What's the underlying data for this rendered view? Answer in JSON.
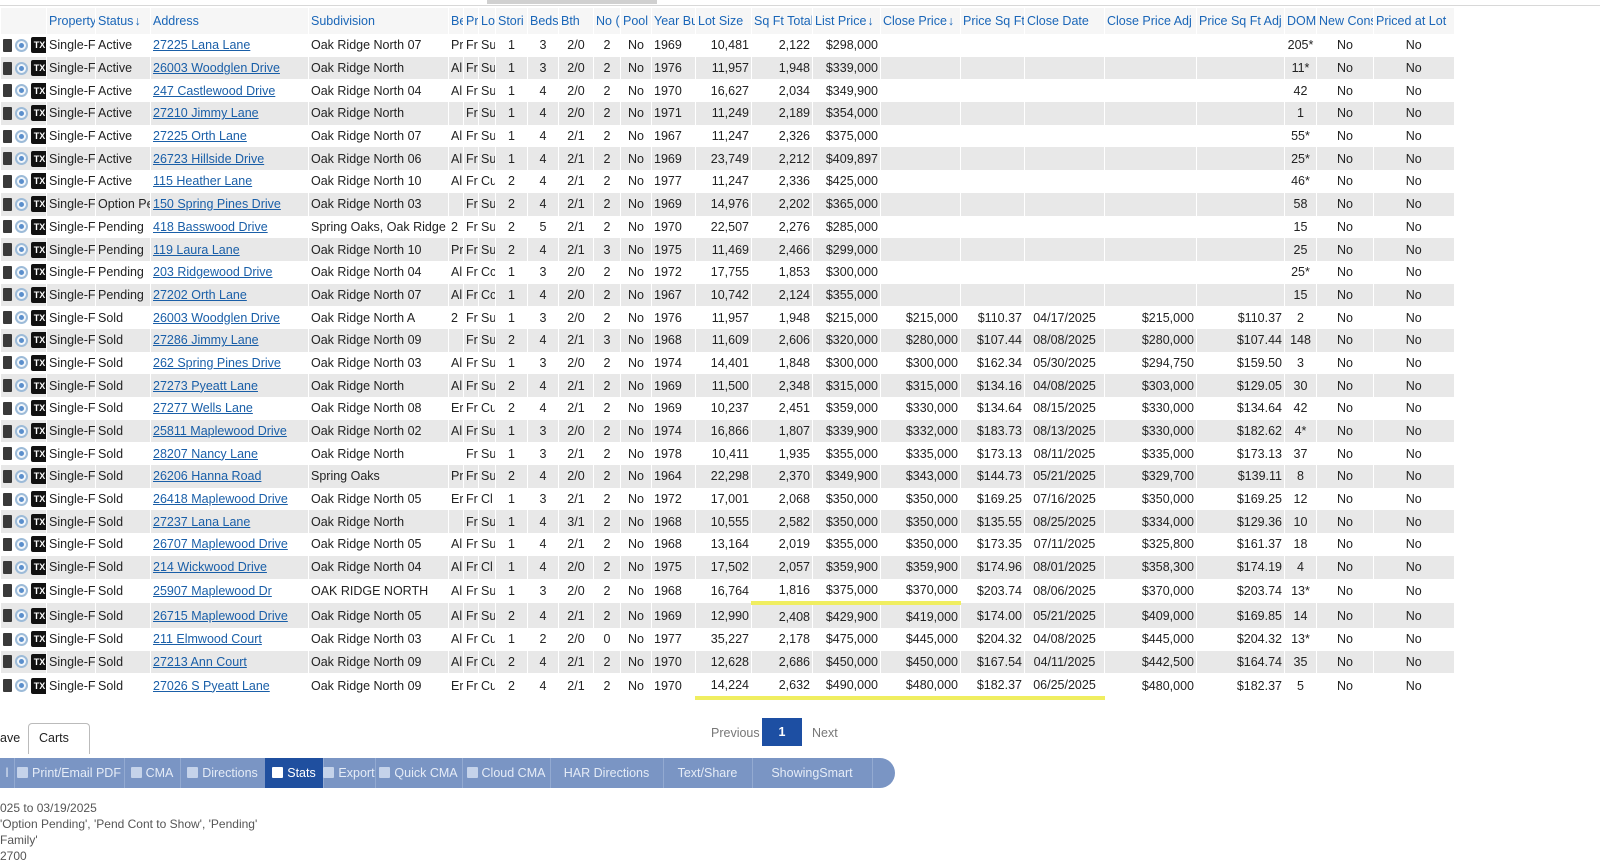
{
  "columns": [
    "",
    "Property",
    "Status",
    "Address",
    "Subdivision",
    "Be",
    "Pr",
    "Lo",
    "Stori",
    "Beds",
    "Bth",
    "No (",
    "Pool",
    "Year Bu",
    "Lot Size",
    "Sq Ft Total",
    "List Price",
    "Close Price",
    "Price Sq Ft",
    "Close Date",
    "Close Price Adj",
    "Price Sq Ft Adj",
    "DOM",
    "New Cons",
    "Priced at Lot"
  ],
  "sort_icons": {
    "status": "↓",
    "list_price": "↓",
    "close_price": "↓"
  },
  "row_icons": {
    "edit": "edit-icon",
    "globe": "globe-icon",
    "tx": "TX"
  },
  "rows": [
    {
      "prop": "Single-F",
      "status": "Active",
      "addr": "27225 Lana Lane",
      "sub": "Oak Ridge North 07",
      "be": "Pr",
      "pr": "Fr",
      "lo": "Su",
      "st": "1",
      "beds": "3",
      "bth": "2/0",
      "no": "2",
      "pool": "No",
      "yr": "1969",
      "lot": "10,481",
      "sqft": "2,122",
      "list": "$298,000",
      "close": "",
      "psf": "",
      "cdate": "",
      "cadj": "",
      "psfadj": "",
      "dom": "205*",
      "newc": "No",
      "lotp": "No"
    },
    {
      "prop": "Single-F",
      "status": "Active",
      "addr": "26003 Woodglen Drive",
      "sub": "Oak Ridge North",
      "be": "Al",
      "pr": "Fr",
      "lo": "Su",
      "st": "1",
      "beds": "3",
      "bth": "2/0",
      "no": "2",
      "pool": "No",
      "yr": "1976",
      "lot": "11,957",
      "sqft": "1,948",
      "list": "$339,000",
      "close": "",
      "psf": "",
      "cdate": "",
      "cadj": "",
      "psfadj": "",
      "dom": "11*",
      "newc": "No",
      "lotp": "No"
    },
    {
      "prop": "Single-F",
      "status": "Active",
      "addr": "247 Castlewood Drive",
      "sub": "Oak Ridge North 04",
      "be": "Al",
      "pr": "Fr",
      "lo": "Su",
      "st": "1",
      "beds": "4",
      "bth": "2/0",
      "no": "2",
      "pool": "No",
      "yr": "1970",
      "lot": "16,627",
      "sqft": "2,034",
      "list": "$349,900",
      "close": "",
      "psf": "",
      "cdate": "",
      "cadj": "",
      "psfadj": "",
      "dom": "42",
      "newc": "No",
      "lotp": "No"
    },
    {
      "prop": "Single-F",
      "status": "Active",
      "addr": "27210 Jimmy Lane",
      "sub": "Oak Ridge North",
      "be": "",
      "pr": "Fr",
      "lo": "Su",
      "st": "1",
      "beds": "4",
      "bth": "2/0",
      "no": "2",
      "pool": "No",
      "yr": "1971",
      "lot": "11,249",
      "sqft": "2,189",
      "list": "$354,000",
      "close": "",
      "psf": "",
      "cdate": "",
      "cadj": "",
      "psfadj": "",
      "dom": "1",
      "newc": "No",
      "lotp": "No"
    },
    {
      "prop": "Single-F",
      "status": "Active",
      "addr": "27225 Orth Lane",
      "sub": "Oak Ridge North 07",
      "be": "Al",
      "pr": "Fr",
      "lo": "Su",
      "st": "1",
      "beds": "4",
      "bth": "2/1",
      "no": "2",
      "pool": "No",
      "yr": "1967",
      "lot": "11,247",
      "sqft": "2,326",
      "list": "$375,000",
      "close": "",
      "psf": "",
      "cdate": "",
      "cadj": "",
      "psfadj": "",
      "dom": "55*",
      "newc": "No",
      "lotp": "No"
    },
    {
      "prop": "Single-F",
      "status": "Active",
      "addr": "26723 Hillside Drive",
      "sub": "Oak Ridge North 06",
      "be": "Al",
      "pr": "Fr",
      "lo": "Su",
      "st": "1",
      "beds": "4",
      "bth": "2/1",
      "no": "2",
      "pool": "No",
      "yr": "1969",
      "lot": "23,749",
      "sqft": "2,212",
      "list": "$409,897",
      "close": "",
      "psf": "",
      "cdate": "",
      "cadj": "",
      "psfadj": "",
      "dom": "25*",
      "newc": "No",
      "lotp": "No"
    },
    {
      "prop": "Single-F",
      "status": "Active",
      "addr": "115 Heather Lane",
      "sub": "Oak Ridge North 10",
      "be": "Al",
      "pr": "Fr",
      "lo": "Cu",
      "st": "2",
      "beds": "4",
      "bth": "2/1",
      "no": "2",
      "pool": "No",
      "yr": "1977",
      "lot": "11,247",
      "sqft": "2,336",
      "list": "$425,000",
      "close": "",
      "psf": "",
      "cdate": "",
      "cadj": "",
      "psfadj": "",
      "dom": "46*",
      "newc": "No",
      "lotp": "No"
    },
    {
      "prop": "Single-F",
      "status": "Option Pe",
      "addr": "150 Spring Pines Drive",
      "sub": "Oak Ridge North 03",
      "be": "",
      "pr": "Fr",
      "lo": "Su",
      "st": "2",
      "beds": "4",
      "bth": "2/1",
      "no": "2",
      "pool": "No",
      "yr": "1969",
      "lot": "14,976",
      "sqft": "2,202",
      "list": "$365,000",
      "close": "",
      "psf": "",
      "cdate": "",
      "cadj": "",
      "psfadj": "",
      "dom": "58",
      "newc": "No",
      "lotp": "No"
    },
    {
      "prop": "Single-F",
      "status": "Pending",
      "addr": "418 Basswood Drive",
      "sub": "Spring Oaks, Oak Ridge &",
      "be": "2",
      "pr": "Fr",
      "lo": "Su",
      "st": "2",
      "beds": "5",
      "bth": "2/1",
      "no": "2",
      "pool": "No",
      "yr": "1970",
      "lot": "22,507",
      "sqft": "2,276",
      "list": "$285,000",
      "close": "",
      "psf": "",
      "cdate": "",
      "cadj": "",
      "psfadj": "",
      "dom": "15",
      "newc": "No",
      "lotp": "No"
    },
    {
      "prop": "Single-F",
      "status": "Pending",
      "addr": "119 Laura Lane",
      "sub": "Oak Ridge North 10",
      "be": "Pr",
      "pr": "Fr",
      "lo": "Su",
      "st": "2",
      "beds": "4",
      "bth": "2/1",
      "no": "3",
      "pool": "No",
      "yr": "1975",
      "lot": "11,469",
      "sqft": "2,466",
      "list": "$299,000",
      "close": "",
      "psf": "",
      "cdate": "",
      "cadj": "",
      "psfadj": "",
      "dom": "25",
      "newc": "No",
      "lotp": "No"
    },
    {
      "prop": "Single-F",
      "status": "Pending",
      "addr": "203 Ridgewood Drive",
      "sub": "Oak Ridge North 04",
      "be": "Al",
      "pr": "Fr",
      "lo": "Cc",
      "st": "1",
      "beds": "3",
      "bth": "2/0",
      "no": "2",
      "pool": "No",
      "yr": "1972",
      "lot": "17,755",
      "sqft": "1,853",
      "list": "$300,000",
      "close": "",
      "psf": "",
      "cdate": "",
      "cadj": "",
      "psfadj": "",
      "dom": "25*",
      "newc": "No",
      "lotp": "No"
    },
    {
      "prop": "Single-F",
      "status": "Pending",
      "addr": "27202 Orth Lane",
      "sub": "Oak Ridge North 07",
      "be": "Al",
      "pr": "Fr",
      "lo": "Cc",
      "st": "1",
      "beds": "4",
      "bth": "2/0",
      "no": "2",
      "pool": "No",
      "yr": "1967",
      "lot": "10,742",
      "sqft": "2,124",
      "list": "$355,000",
      "close": "",
      "psf": "",
      "cdate": "",
      "cadj": "",
      "psfadj": "",
      "dom": "15",
      "newc": "No",
      "lotp": "No"
    },
    {
      "prop": "Single-F",
      "status": "Sold",
      "addr": "26003 Woodglen Drive",
      "sub": "Oak Ridge North A",
      "be": "2",
      "pr": "Fr",
      "lo": "Su",
      "st": "1",
      "beds": "3",
      "bth": "2/0",
      "no": "2",
      "pool": "No",
      "yr": "1976",
      "lot": "11,957",
      "sqft": "1,948",
      "list": "$215,000",
      "close": "$215,000",
      "psf": "$110.37",
      "cdate": "04/17/2025",
      "cadj": "$215,000",
      "psfadj": "$110.37",
      "dom": "2",
      "newc": "No",
      "lotp": "No"
    },
    {
      "prop": "Single-F",
      "status": "Sold",
      "addr": "27286 Jimmy Lane",
      "sub": "Oak Ridge North 09",
      "be": "",
      "pr": "Fr",
      "lo": "Su",
      "st": "2",
      "beds": "4",
      "bth": "2/1",
      "no": "3",
      "pool": "No",
      "yr": "1968",
      "lot": "11,609",
      "sqft": "2,606",
      "list": "$320,000",
      "close": "$280,000",
      "psf": "$107.44",
      "cdate": "08/08/2025",
      "cadj": "$280,000",
      "psfadj": "$107.44",
      "dom": "148",
      "newc": "No",
      "lotp": "No"
    },
    {
      "prop": "Single-F",
      "status": "Sold",
      "addr": "262 Spring Pines Drive",
      "sub": "Oak Ridge North 03",
      "be": "Al",
      "pr": "Fr",
      "lo": "Su",
      "st": "1",
      "beds": "3",
      "bth": "2/0",
      "no": "2",
      "pool": "No",
      "yr": "1974",
      "lot": "14,401",
      "sqft": "1,848",
      "list": "$300,000",
      "close": "$300,000",
      "psf": "$162.34",
      "cdate": "05/30/2025",
      "cadj": "$294,750",
      "psfadj": "$159.50",
      "dom": "3",
      "newc": "No",
      "lotp": "No"
    },
    {
      "prop": "Single-F",
      "status": "Sold",
      "addr": "27273 Pyeatt Lane",
      "sub": "Oak Ridge North",
      "be": "Al",
      "pr": "Fr",
      "lo": "Su",
      "st": "2",
      "beds": "4",
      "bth": "2/1",
      "no": "2",
      "pool": "No",
      "yr": "1969",
      "lot": "11,500",
      "sqft": "2,348",
      "list": "$315,000",
      "close": "$315,000",
      "psf": "$134.16",
      "cdate": "04/08/2025",
      "cadj": "$303,000",
      "psfadj": "$129.05",
      "dom": "30",
      "newc": "No",
      "lotp": "No"
    },
    {
      "prop": "Single-F",
      "status": "Sold",
      "addr": "27277 Wells Lane",
      "sub": "Oak Ridge North 08",
      "be": "Er",
      "pr": "Fr",
      "lo": "Cu",
      "st": "2",
      "beds": "4",
      "bth": "2/1",
      "no": "2",
      "pool": "No",
      "yr": "1969",
      "lot": "10,237",
      "sqft": "2,451",
      "list": "$359,000",
      "close": "$330,000",
      "psf": "$134.64",
      "cdate": "08/15/2025",
      "cadj": "$330,000",
      "psfadj": "$134.64",
      "dom": "42",
      "newc": "No",
      "lotp": "No"
    },
    {
      "prop": "Single-F",
      "status": "Sold",
      "addr": "25811 Maplewood Drive",
      "sub": "Oak Ridge North 02",
      "be": "Al",
      "pr": "Fr",
      "lo": "Su",
      "st": "1",
      "beds": "3",
      "bth": "2/0",
      "no": "2",
      "pool": "No",
      "yr": "1974",
      "lot": "16,866",
      "sqft": "1,807",
      "list": "$339,900",
      "close": "$332,000",
      "psf": "$183.73",
      "cdate": "08/13/2025",
      "cadj": "$330,000",
      "psfadj": "$182.62",
      "dom": "4*",
      "newc": "No",
      "lotp": "No"
    },
    {
      "prop": "Single-F",
      "status": "Sold",
      "addr": "28207 Nancy Lane",
      "sub": "Oak Ridge North",
      "be": "",
      "pr": "Fr",
      "lo": "Su",
      "st": "1",
      "beds": "3",
      "bth": "2/1",
      "no": "2",
      "pool": "No",
      "yr": "1978",
      "lot": "10,411",
      "sqft": "1,935",
      "list": "$355,000",
      "close": "$335,000",
      "psf": "$173.13",
      "cdate": "08/11/2025",
      "cadj": "$335,000",
      "psfadj": "$173.13",
      "dom": "37",
      "newc": "No",
      "lotp": "No"
    },
    {
      "prop": "Single-F",
      "status": "Sold",
      "addr": "26206 Hanna Road",
      "sub": "Spring Oaks",
      "be": "Pr",
      "pr": "Fr",
      "lo": "Su",
      "st": "2",
      "beds": "4",
      "bth": "2/0",
      "no": "2",
      "pool": "No",
      "yr": "1964",
      "lot": "22,298",
      "sqft": "2,370",
      "list": "$349,900",
      "close": "$343,000",
      "psf": "$144.73",
      "cdate": "05/21/2025",
      "cadj": "$329,700",
      "psfadj": "$139.11",
      "dom": "8",
      "newc": "No",
      "lotp": "No"
    },
    {
      "prop": "Single-F",
      "status": "Sold",
      "addr": "26418 Maplewood Drive",
      "sub": "Oak Ridge North 05",
      "be": "Er",
      "pr": "Fr",
      "lo": "Cl",
      "st": "1",
      "beds": "3",
      "bth": "2/1",
      "no": "2",
      "pool": "No",
      "yr": "1972",
      "lot": "17,001",
      "sqft": "2,068",
      "list": "$350,000",
      "close": "$350,000",
      "psf": "$169.25",
      "cdate": "07/16/2025",
      "cadj": "$350,000",
      "psfadj": "$169.25",
      "dom": "12",
      "newc": "No",
      "lotp": "No"
    },
    {
      "prop": "Single-F",
      "status": "Sold",
      "addr": "27237 Lana Lane",
      "sub": "Oak Ridge North",
      "be": "",
      "pr": "Fr",
      "lo": "Su",
      "st": "1",
      "beds": "4",
      "bth": "3/1",
      "no": "2",
      "pool": "No",
      "yr": "1968",
      "lot": "10,555",
      "sqft": "2,582",
      "list": "$350,000",
      "close": "$350,000",
      "psf": "$135.55",
      "cdate": "08/25/2025",
      "cadj": "$334,000",
      "psfadj": "$129.36",
      "dom": "10",
      "newc": "No",
      "lotp": "No"
    },
    {
      "prop": "Single-F",
      "status": "Sold",
      "addr": "26707 Maplewood Drive",
      "sub": "Oak Ridge North 05",
      "be": "Al",
      "pr": "Fr",
      "lo": "Su",
      "st": "1",
      "beds": "4",
      "bth": "2/1",
      "no": "2",
      "pool": "No",
      "yr": "1968",
      "lot": "13,164",
      "sqft": "2,019",
      "list": "$355,000",
      "close": "$350,000",
      "psf": "$173.35",
      "cdate": "07/11/2025",
      "cadj": "$325,800",
      "psfadj": "$161.37",
      "dom": "18",
      "newc": "No",
      "lotp": "No"
    },
    {
      "prop": "Single-F",
      "status": "Sold",
      "addr": "214 Wickwood Drive",
      "sub": "Oak Ridge North 04",
      "be": "Al",
      "pr": "Fr",
      "lo": "Cl",
      "st": "1",
      "beds": "4",
      "bth": "2/0",
      "no": "2",
      "pool": "No",
      "yr": "1975",
      "lot": "17,502",
      "sqft": "2,057",
      "list": "$359,900",
      "close": "$359,900",
      "psf": "$174.96",
      "cdate": "08/01/2025",
      "cadj": "$358,300",
      "psfadj": "$174.19",
      "dom": "4",
      "newc": "No",
      "lotp": "No"
    },
    {
      "prop": "Single-F",
      "status": "Sold",
      "addr": "25907 Maplewood Dr",
      "sub": "OAK RIDGE NORTH",
      "be": "Al",
      "pr": "Fr",
      "lo": "Su",
      "st": "1",
      "beds": "3",
      "bth": "2/0",
      "no": "2",
      "pool": "No",
      "yr": "1968",
      "lot": "16,764",
      "sqft": "1,816",
      "list": "$375,000",
      "close": "$370,000",
      "psf": "$203.74",
      "cdate": "08/06/2025",
      "cadj": "$370,000",
      "psfadj": "$203.74",
      "dom": "13*",
      "newc": "No",
      "lotp": "No"
    },
    {
      "prop": "Single-F",
      "status": "Sold",
      "addr": "26715 Maplewood Drive",
      "sub": "Oak Ridge North 05",
      "be": "Al",
      "pr": "Fr",
      "lo": "Su",
      "st": "2",
      "beds": "4",
      "bth": "2/1",
      "no": "2",
      "pool": "No",
      "yr": "1969",
      "lot": "12,990",
      "sqft": "2,408",
      "list": "$429,900",
      "close": "$419,000",
      "psf": "$174.00",
      "cdate": "05/21/2025",
      "cadj": "$409,000",
      "psfadj": "$169.85",
      "dom": "14",
      "newc": "No",
      "lotp": "No"
    },
    {
      "prop": "Single-F",
      "status": "Sold",
      "addr": "211 Elmwood Court",
      "sub": "Oak Ridge North 03",
      "be": "Al",
      "pr": "Fr",
      "lo": "Cu",
      "st": "1",
      "beds": "2",
      "bth": "2/0",
      "no": "0",
      "pool": "No",
      "yr": "1977",
      "lot": "35,227",
      "sqft": "2,178",
      "list": "$475,000",
      "close": "$445,000",
      "psf": "$204.32",
      "cdate": "04/08/2025",
      "cadj": "$445,000",
      "psfadj": "$204.32",
      "dom": "13*",
      "newc": "No",
      "lotp": "No"
    },
    {
      "prop": "Single-F",
      "status": "Sold",
      "addr": "27213 Ann Court",
      "sub": "Oak Ridge North 09",
      "be": "Al",
      "pr": "Fr",
      "lo": "Cu",
      "st": "2",
      "beds": "4",
      "bth": "2/1",
      "no": "2",
      "pool": "No",
      "yr": "1970",
      "lot": "12,628",
      "sqft": "2,686",
      "list": "$450,000",
      "close": "$450,000",
      "psf": "$167.54",
      "cdate": "04/11/2025",
      "cadj": "$442,500",
      "psfadj": "$164.74",
      "dom": "35",
      "newc": "No",
      "lotp": "No"
    },
    {
      "prop": "Single-F",
      "status": "Sold",
      "addr": "27026 S Pyeatt Lane",
      "sub": "Oak Ridge North 09",
      "be": "Er",
      "pr": "Fr",
      "lo": "Cu",
      "st": "2",
      "beds": "4",
      "bth": "2/1",
      "no": "2",
      "pool": "No",
      "yr": "1970",
      "lot": "14,224",
      "sqft": "2,632",
      "list": "$490,000",
      "close": "$480,000",
      "psf": "$182.37",
      "cdate": "06/25/2025",
      "cadj": "$480,000",
      "psfadj": "$182.37",
      "dom": "5",
      "newc": "No",
      "lotp": "No"
    }
  ],
  "bottom_tabs": {
    "left": "ave",
    "carts": "Carts"
  },
  "pager": {
    "prev": "Previous",
    "current": "1",
    "next": "Next"
  },
  "toolbar": [
    {
      "label": "l",
      "icon": "",
      "active": false
    },
    {
      "label": "Print/Email PDF",
      "icon": "print-icon",
      "active": false
    },
    {
      "label": "CMA",
      "icon": "cma-icon",
      "active": false
    },
    {
      "label": "Directions",
      "icon": "directions-icon",
      "active": false
    },
    {
      "label": "Stats",
      "icon": "bar-chart-icon",
      "active": true
    },
    {
      "label": "Export",
      "icon": "export-icon",
      "active": false
    },
    {
      "label": "Quick CMA",
      "icon": "quick-cma-icon",
      "active": false
    },
    {
      "label": "Cloud CMA",
      "icon": "cloud-cma-icon",
      "active": false
    },
    {
      "label": "HAR Directions",
      "icon": "",
      "active": false
    },
    {
      "label": "Text/Share",
      "icon": "",
      "active": false
    },
    {
      "label": "ShowingSmart",
      "icon": "",
      "active": false
    }
  ],
  "criteria": [
    "025 to 03/19/2025",
    "'Option Pending', 'Pend Cont to Show', 'Pending'",
    "Family'",
    "2700"
  ],
  "highlight_color": "#f3f36a"
}
